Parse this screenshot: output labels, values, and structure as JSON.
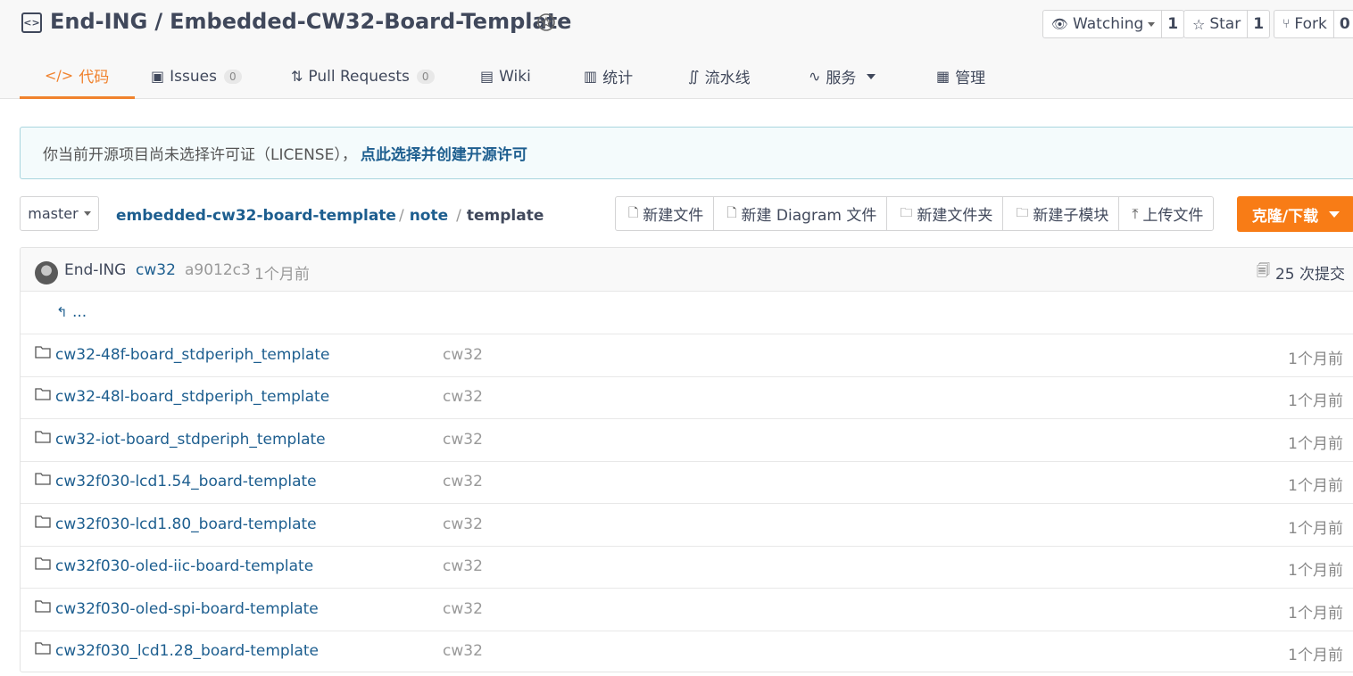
{
  "header": {
    "owner": "End-ING",
    "separator": "/",
    "repo": "Embedded-CW32-Board-Template",
    "watch": {
      "label": "Watching",
      "count": "1"
    },
    "star": {
      "label": "Star",
      "count": "1"
    },
    "fork": {
      "label": "Fork",
      "count": "0"
    }
  },
  "tabs": [
    {
      "label": "代码",
      "icon": "code-icon",
      "active": true
    },
    {
      "label": "Issues",
      "icon": "issues-icon",
      "badge": "0"
    },
    {
      "label": "Pull Requests",
      "icon": "pull-request-icon",
      "badge": "0"
    },
    {
      "label": "Wiki",
      "icon": "wiki-icon"
    },
    {
      "label": "统计",
      "icon": "chart-icon"
    },
    {
      "label": "流水线",
      "icon": "pipeline-icon"
    },
    {
      "label": "服务",
      "icon": "pulse-icon"
    },
    {
      "label": "管理",
      "icon": "settings-doc-icon"
    }
  ],
  "notice": {
    "text": "你当前开源项目尚未选择许可证（LICENSE），",
    "link": "点此选择并创建开源许可"
  },
  "toolbar": {
    "branch": "master",
    "breadcrumb": [
      "embedded-cw32-board-template",
      "note",
      "template"
    ],
    "actions": [
      "新建文件",
      "新建 Diagram 文件",
      "新建文件夹",
      "新建子模块",
      "上传文件"
    ],
    "clone": "克隆/下载"
  },
  "commit": {
    "author": "End-ING",
    "message": "cw32",
    "sha": "a9012c3",
    "time": "1个月前",
    "count": "25 次提交"
  },
  "back": "...",
  "files": [
    {
      "name": "cw32-48f-board_stdperiph_template",
      "message": "cw32",
      "time": "1个月前"
    },
    {
      "name": "cw32-48l-board_stdperiph_template",
      "message": "cw32",
      "time": "1个月前"
    },
    {
      "name": "cw32-iot-board_stdperiph_template",
      "message": "cw32",
      "time": "1个月前"
    },
    {
      "name": "cw32f030-lcd1.54_board-template",
      "message": "cw32",
      "time": "1个月前"
    },
    {
      "name": "cw32f030-lcd1.80_board-template",
      "message": "cw32",
      "time": "1个月前"
    },
    {
      "name": "cw32f030-oled-iic-board-template",
      "message": "cw32",
      "time": "1个月前"
    },
    {
      "name": "cw32f030-oled-spi-board-template",
      "message": "cw32",
      "time": "1个月前"
    },
    {
      "name": "cw32f030_lcd1.28_board-template",
      "message": "cw32",
      "time": "1个月前"
    }
  ],
  "colors": {
    "accent": "#f0822d",
    "clone_button": "#f87c16",
    "link": "#1d5e8f"
  }
}
